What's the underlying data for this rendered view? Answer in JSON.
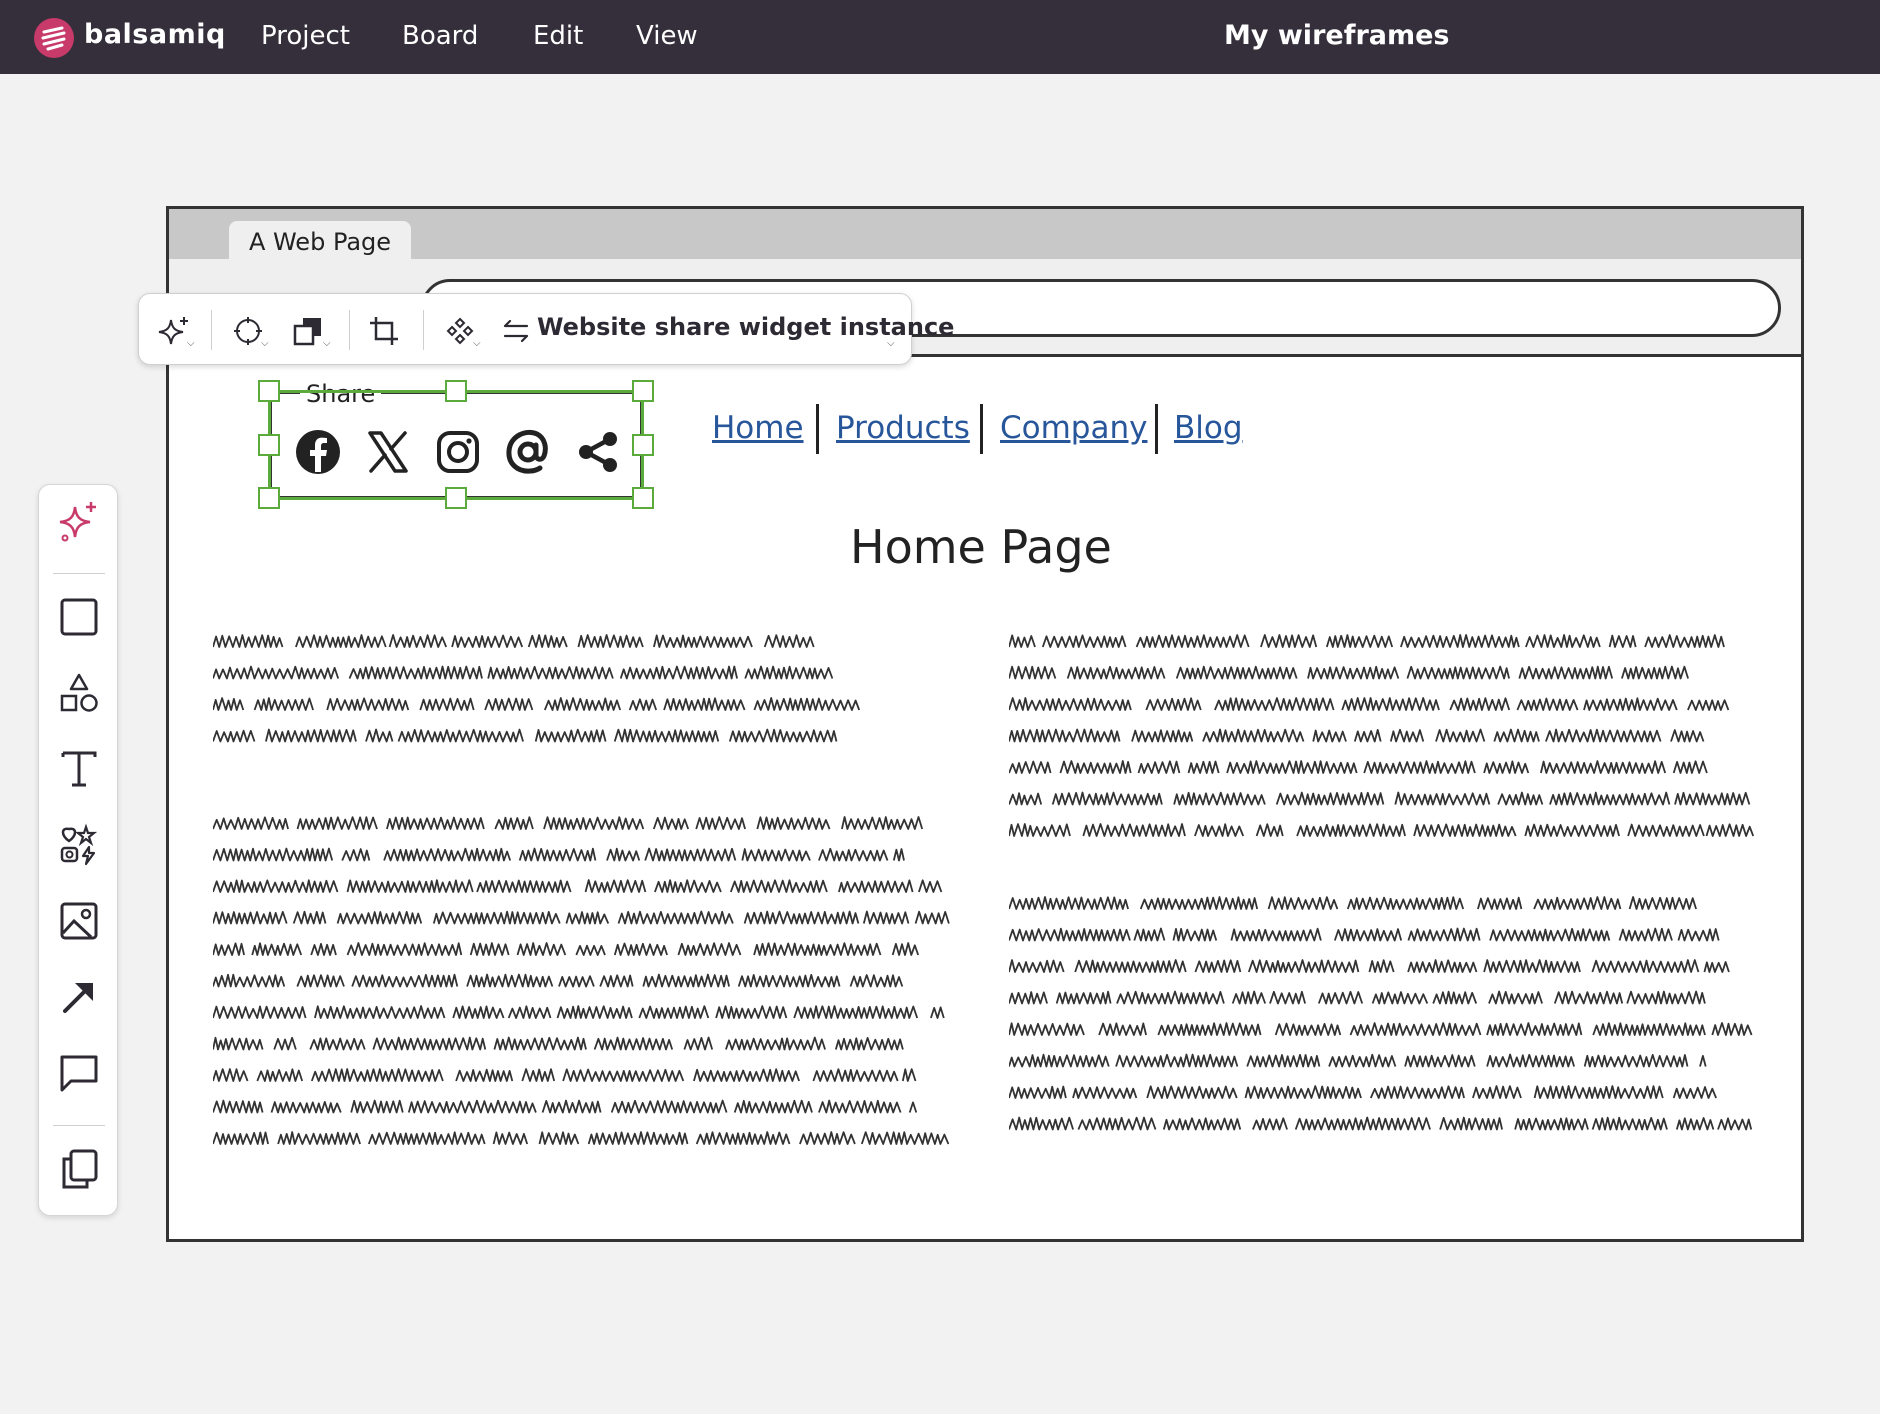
{
  "app": {
    "brand": "balsamiq",
    "menu": [
      "Project",
      "Board",
      "Edit",
      "View"
    ],
    "project_title": "My wireframes",
    "colors": {
      "topbar": "#352f3b",
      "brand_accent": "#c73a6a",
      "selection": "#5aab3c",
      "link": "#27569b"
    }
  },
  "toolbar": {
    "buttons": [
      "ai-sparkle-icon",
      "target-icon",
      "layers-icon",
      "crop-icon",
      "symbol-icon",
      "swap-icon"
    ],
    "symbol_label": "Website share widget instance"
  },
  "wireframe": {
    "tab_label": "A Web Page",
    "share_widget": {
      "title": "Share",
      "icons": [
        "facebook-icon",
        "x-twitter-icon",
        "instagram-icon",
        "at-sign-icon",
        "share-icon"
      ]
    },
    "nav_links": [
      "Home",
      "Products",
      "Company",
      "Blog"
    ],
    "page_heading": "Home Page"
  },
  "palette": {
    "tools": [
      "ai-sparkle-icon",
      "rectangle-icon",
      "shapes-icon",
      "text-icon",
      "icons-icon",
      "image-icon",
      "arrow-icon",
      "comment-icon",
      "copy-icon"
    ]
  }
}
